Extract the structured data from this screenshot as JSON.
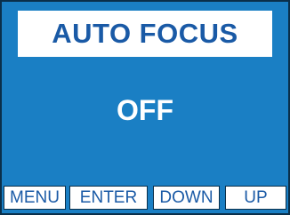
{
  "screen": {
    "title": "AUTO FOCUS",
    "value": "OFF",
    "softkeys": [
      {
        "label": "MENU"
      },
      {
        "label": "ENTER"
      },
      {
        "label": "DOWN"
      },
      {
        "label": "UP"
      }
    ]
  },
  "colors": {
    "background": "#1a7fc4",
    "title_text": "#1a5aa6",
    "value_text": "#ffffff",
    "softkey_bg": "#ffffff"
  }
}
